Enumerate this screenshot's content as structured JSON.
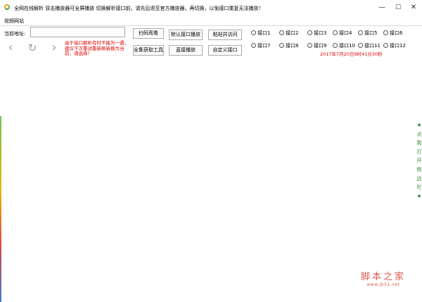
{
  "window": {
    "title": "全网在线解析  双击播放器可全屏播放   切换解析接口前，请先后退至官方播放器，再切换，以免接口重复无法播放！",
    "controls": {
      "minimize": "—",
      "maximize": "☐",
      "close": "✕"
    }
  },
  "menu": {
    "items": [
      "视频网站"
    ]
  },
  "address": {
    "label": "当前地址:",
    "value": "",
    "placeholder": ""
  },
  "nav": {
    "back": "‹",
    "refresh": "↻",
    "forward": "›"
  },
  "note": "由于接口解析有时不能为一遇，建议下次重试重新刷新换为当前，请选择！",
  "buttons": {
    "scan": "扫码观看",
    "default_play": "默认接口播放",
    "paste_visit": "粘贴并访问",
    "get_tool": "全集获取工具",
    "direct_play": "直接播放",
    "custom": "自定义接口"
  },
  "interfaces": [
    "接口1",
    "接口2",
    "接口3",
    "接口4",
    "接口5",
    "接口6",
    "接口7",
    "接口8",
    "接口9",
    "接口10",
    "接口11",
    "接口12"
  ],
  "date_text": "2017年7月20日9时41分30秒",
  "side_panel": {
    "top": "◆",
    "chars": [
      "点",
      "我",
      "打",
      "开",
      "侧",
      "边",
      "栏"
    ],
    "bottom": "◆"
  },
  "watermark": {
    "main": "脚本之家",
    "sub": "www.jb51.net"
  }
}
